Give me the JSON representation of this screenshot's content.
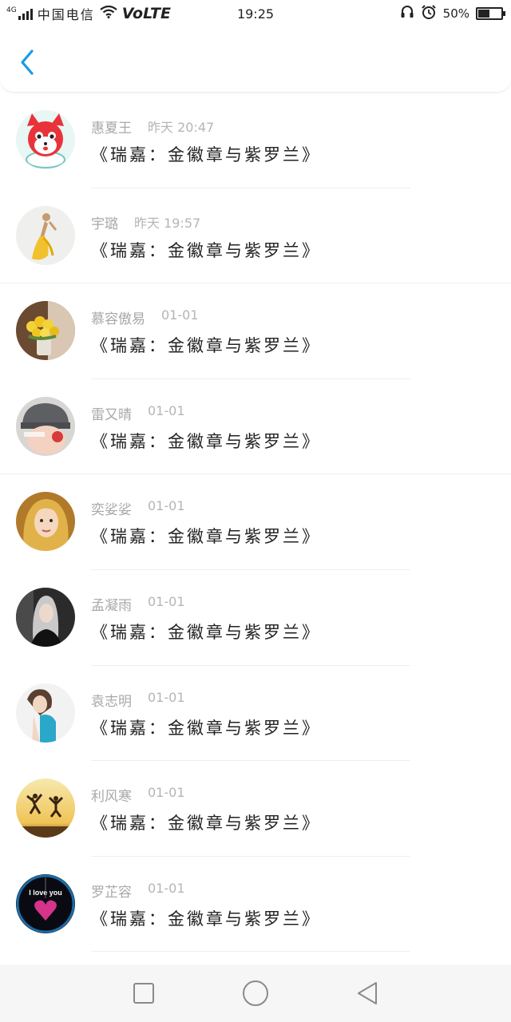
{
  "status_bar": {
    "network": "4G",
    "carrier": "中国电信",
    "volte": "VoLTE",
    "time": "19:25",
    "battery": "50%",
    "battery_level": 0.5,
    "icons": [
      "signal-icon",
      "wifi-icon",
      "headphones-icon",
      "alarm-icon",
      "battery-icon"
    ]
  },
  "header": {
    "back_icon": "chevron-left-icon"
  },
  "accent_color": "#1a9be6",
  "list": [
    {
      "name": "惠夏王",
      "time": "昨天 20:47",
      "title": "《瑞嘉：金徽章与紫罗兰》",
      "avatar": "cartoon-fox"
    },
    {
      "name": "宇璐",
      "time": "昨天 19:57",
      "title": "《瑞嘉：金徽章与紫罗兰》",
      "avatar": "figure-yellow-dress"
    },
    {
      "name": "慕容傲易",
      "time": "01-01",
      "title": "《瑞嘉：金徽章与紫罗兰》",
      "avatar": "yellow-flowers"
    },
    {
      "name": "雷又晴",
      "time": "01-01",
      "title": "《瑞嘉：金徽章与紫罗兰》",
      "avatar": "boy-gray-cap"
    },
    {
      "name": "奕娑娑",
      "time": "01-01",
      "title": "《瑞嘉：金徽章与紫罗兰》",
      "avatar": "blonde-girl"
    },
    {
      "name": "孟凝雨",
      "time": "01-01",
      "title": "《瑞嘉：金徽章与紫罗兰》",
      "avatar": "gray-hair-girl"
    },
    {
      "name": "袁志明",
      "time": "01-01",
      "title": "《瑞嘉：金徽章与紫罗兰》",
      "avatar": "girl-blue-top"
    },
    {
      "name": "利风寒",
      "time": "01-01",
      "title": "《瑞嘉：金徽章与紫罗兰》",
      "avatar": "jumping-silhouettes"
    },
    {
      "name": "罗芷容",
      "time": "01-01",
      "title": "《瑞嘉：金徽章与紫罗兰》",
      "avatar": "i-love-you-heart",
      "avatar_text": "I love you"
    }
  ],
  "nav": {
    "recent_icon": "square-icon",
    "home_icon": "circle-icon",
    "back_icon": "triangle-back-icon"
  }
}
